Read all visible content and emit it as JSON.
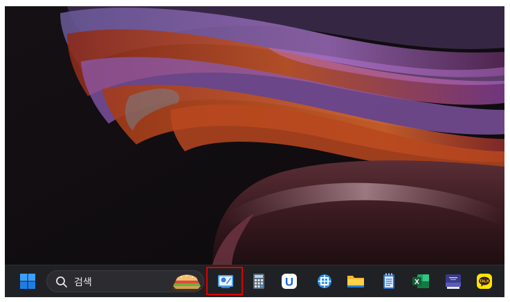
{
  "taskbar": {
    "search": {
      "label": "검색",
      "icon": "search-icon"
    },
    "apps": [
      {
        "name": "start",
        "icon": "windows-logo-icon"
      },
      {
        "name": "paint",
        "icon": "paint-app-icon",
        "highlighted": true
      },
      {
        "name": "calculator",
        "icon": "calculator-icon"
      },
      {
        "name": "u-app",
        "icon": "u-app-icon"
      },
      {
        "name": "snipping-tool",
        "icon": "snipping-tool-icon"
      },
      {
        "name": "file-explorer",
        "icon": "folder-icon"
      },
      {
        "name": "notepad",
        "icon": "notepad-icon"
      },
      {
        "name": "excel",
        "icon": "excel-icon"
      },
      {
        "name": "dictionary",
        "icon": "book-icon"
      },
      {
        "name": "kakaotalk",
        "icon": "kakaotalk-icon"
      }
    ],
    "kakaotalk_label": "TALK",
    "excel_letter": "X",
    "u_letter": "U"
  },
  "colors": {
    "taskbar_bg": "#202124",
    "highlight": "#e00000",
    "windows_blue": "#1e90ff",
    "excel_green": "#1e7b45",
    "kakao_yellow": "#fee500"
  }
}
